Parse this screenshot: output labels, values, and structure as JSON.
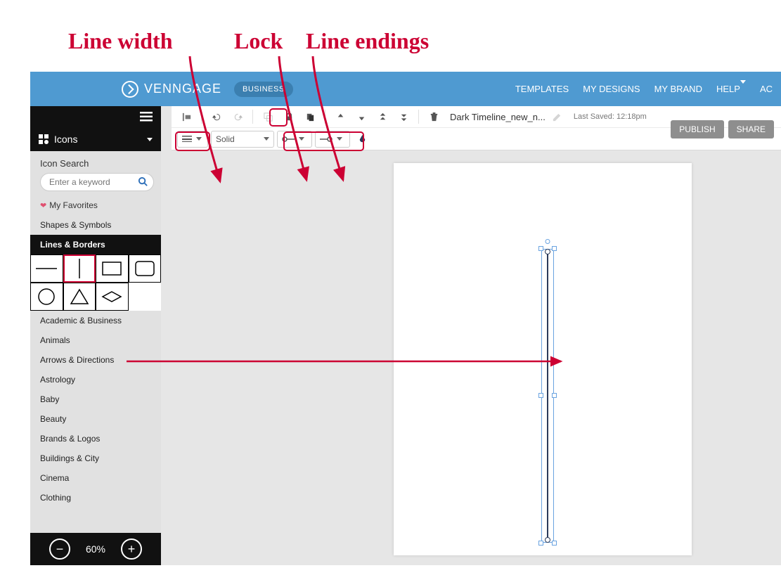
{
  "annotations": {
    "line_width": "Line width",
    "lock": "Lock",
    "line_endings": "Line endings"
  },
  "header": {
    "brand": "VENNGAGE",
    "plan": "BUSINESS",
    "nav": {
      "templates": "TEMPLATES",
      "my_designs": "MY DESIGNS",
      "my_brand": "MY BRAND",
      "help": "HELP",
      "acc": "AC"
    }
  },
  "actions": {
    "publish": "PUBLISH",
    "share": "SHARE"
  },
  "toolbar": {
    "doc_title": "Dark Timeline_new_n...",
    "last_saved": "Last Saved: 12:18pm",
    "line_style": "Solid"
  },
  "sidebar": {
    "panel_title": "Icons",
    "search_title": "Icon Search",
    "search_placeholder": "Enter a keyword",
    "favorites": "My Favorites",
    "section_shapes": "Shapes & Symbols",
    "section_lines": "Lines & Borders",
    "categories": [
      "Academic & Business",
      "Animals",
      "Arrows & Directions",
      "Astrology",
      "Baby",
      "Beauty",
      "Brands & Logos",
      "Buildings & City",
      "Cinema",
      "Clothing"
    ]
  },
  "zoom": {
    "level": "60%"
  }
}
